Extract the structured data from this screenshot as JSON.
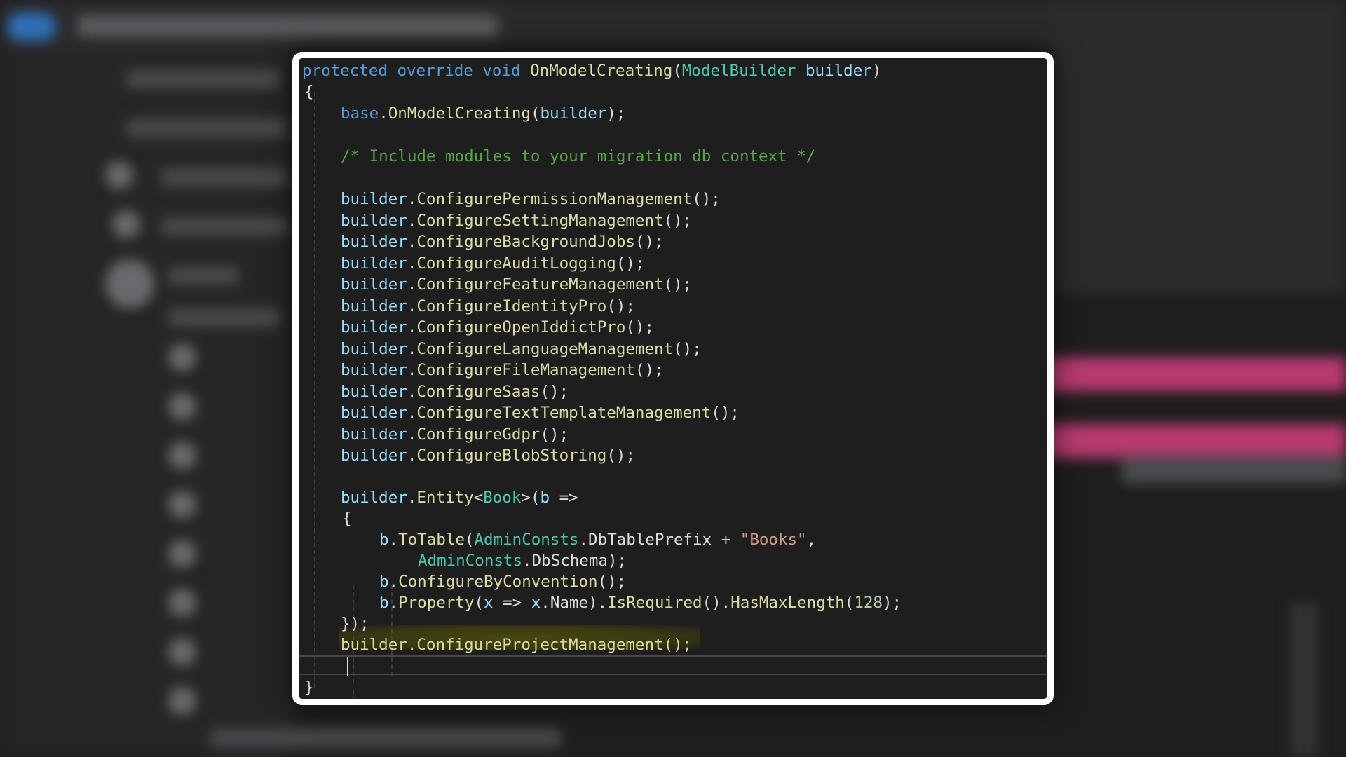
{
  "code": {
    "signature": {
      "modifier1": "protected",
      "modifier2": "override",
      "return_type": "void",
      "method": "OnModelCreating",
      "param_type": "ModelBuilder",
      "param_name": "builder"
    },
    "base_keyword": "base",
    "base_call_method": "OnModelCreating",
    "base_call_arg": "builder",
    "comment": "/* Include modules to your migration db context */",
    "receiver": "builder",
    "module_calls": [
      "ConfigurePermissionManagement",
      "ConfigureSettingManagement",
      "ConfigureBackgroundJobs",
      "ConfigureAuditLogging",
      "ConfigureFeatureManagement",
      "ConfigureIdentityPro",
      "ConfigureOpenIddictPro",
      "ConfigureLanguageManagement",
      "ConfigureFileManagement",
      "ConfigureSaas",
      "ConfigureTextTemplateManagement",
      "ConfigureGdpr",
      "ConfigureBlobStoring"
    ],
    "entity": {
      "method": "Entity",
      "type": "Book",
      "lambda_var": "b",
      "to_table_method": "ToTable",
      "consts_class": "AdminConsts",
      "prefix_member": "DbTablePrefix",
      "table_name": "\"Books\"",
      "schema_member": "DbSchema",
      "configure_method": "ConfigureByConvention",
      "property_method": "Property",
      "property_lambda_var": "x",
      "property_member": "Name",
      "required_method": "IsRequired",
      "max_length_method": "HasMaxLength",
      "max_length": "128"
    },
    "highlighted_call": "builder.ConfigureProjectManagement();"
  },
  "colors": {
    "keyword": "#569cd6",
    "method": "#dcdcaa",
    "type": "#4ec9b0",
    "variable": "#9cdcfe",
    "comment": "#57a64a",
    "string": "#d69d85",
    "number": "#b5cea8",
    "highlight": "#6b6b00"
  }
}
